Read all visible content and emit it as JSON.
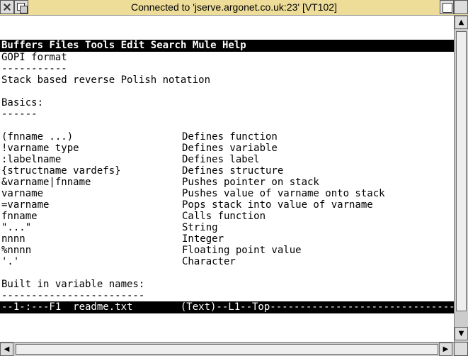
{
  "window": {
    "title": "Connected to 'jserve.argonet.co.uk:23' [VT102]"
  },
  "menubar": {
    "items": [
      "Buffers",
      "Files",
      "Tools",
      "Edit",
      "Search",
      "Mule",
      "Help"
    ]
  },
  "buffer": {
    "lines": [
      {
        "a": "GOPI format",
        "b": ""
      },
      {
        "a": "-----------",
        "b": ""
      },
      {
        "a": "Stack based reverse Polish notation",
        "b": ""
      },
      {
        "a": "",
        "b": ""
      },
      {
        "a": "Basics:",
        "b": ""
      },
      {
        "a": "------",
        "b": ""
      },
      {
        "a": "",
        "b": ""
      },
      {
        "a": "(fnname ...)",
        "b": "Defines function"
      },
      {
        "a": "!varname type",
        "b": "Defines variable"
      },
      {
        "a": ":labelname",
        "b": "Defines label"
      },
      {
        "a": "{structname vardefs}",
        "b": "Defines structure"
      },
      {
        "a": "&varname|fnname",
        "b": "Pushes pointer on stack"
      },
      {
        "a": "varname",
        "b": "Pushes value of varname onto stack"
      },
      {
        "a": "=varname",
        "b": "Pops stack into value of varname"
      },
      {
        "a": "fnname",
        "b": "Calls function"
      },
      {
        "a": "\"...\"",
        "b": "String"
      },
      {
        "a": "nnnn",
        "b": "Integer"
      },
      {
        "a": "%nnnn",
        "b": "Floating point value"
      },
      {
        "a": "'.'",
        "b": "Character"
      },
      {
        "a": "",
        "b": ""
      },
      {
        "a": "Built in variable names:",
        "b": ""
      },
      {
        "a": "------------------------",
        "b": ""
      }
    ]
  },
  "modeline": {
    "text": "--1-:---F1  readme.txt        (Text)--L1--Top-------------------------------------"
  },
  "colors": {
    "title_bar": "#eedd99",
    "terminal_bg": "#ffffff",
    "inverse_bg": "#000000"
  }
}
